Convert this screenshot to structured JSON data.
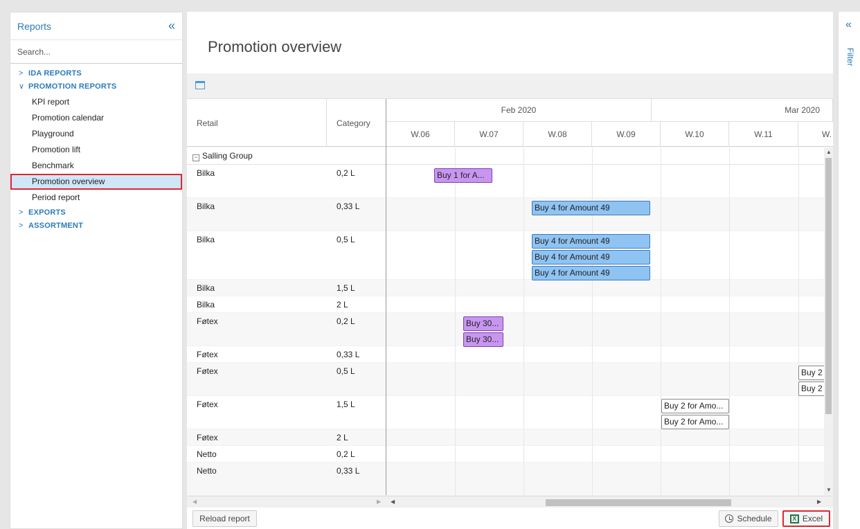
{
  "sidebar": {
    "title": "Reports",
    "collapse_icon": "«",
    "search_placeholder": "Search...",
    "groups": [
      {
        "label": "IDA REPORTS",
        "expanded": false,
        "items": []
      },
      {
        "label": "PROMOTION REPORTS",
        "expanded": true,
        "items": [
          "KPI report",
          "Promotion calendar",
          "Playground",
          "Promotion lift",
          "Benchmark",
          "Promotion overview",
          "Period report"
        ]
      },
      {
        "label": "EXPORTS",
        "expanded": false,
        "items": []
      },
      {
        "label": "ASSORTMENT",
        "expanded": false,
        "items": []
      }
    ],
    "active_item": "Promotion overview"
  },
  "main": {
    "title": "Promotion overview",
    "columns": {
      "retail": "Retail",
      "category": "Category"
    },
    "months": [
      "Feb 2020",
      "Mar 2020"
    ],
    "weeks": [
      "W.06",
      "W.07",
      "W.08",
      "W.09",
      "W.10",
      "W.11",
      "W."
    ],
    "group": "Salling Group",
    "rows": [
      {
        "retail": "Bilka",
        "category": "0,2 L"
      },
      {
        "retail": "Bilka",
        "category": "0,33 L"
      },
      {
        "retail": "Bilka",
        "category": "0,5 L"
      },
      {
        "retail": "Bilka",
        "category": "1,5 L"
      },
      {
        "retail": "Bilka",
        "category": "2 L"
      },
      {
        "retail": "Føtex",
        "category": "0,2 L"
      },
      {
        "retail": "Føtex",
        "category": "0,33 L"
      },
      {
        "retail": "Føtex",
        "category": "0,5 L"
      },
      {
        "retail": "Føtex",
        "category": "1,5 L"
      },
      {
        "retail": "Føtex",
        "category": "2 L"
      },
      {
        "retail": "Netto",
        "category": "0,2 L"
      },
      {
        "retail": "Netto",
        "category": "0,33 L"
      }
    ],
    "promotions": [
      {
        "label": "Buy 1 for A...",
        "color": "purple"
      },
      {
        "label": "Buy 4 for Amount 49",
        "color": "blue"
      },
      {
        "label": "Buy 4 for Amount 49",
        "color": "blue"
      },
      {
        "label": "Buy 4 for Amount 49",
        "color": "blue"
      },
      {
        "label": "Buy 4 for Amount 49",
        "color": "blue"
      },
      {
        "label": "Buy 30...",
        "color": "purple"
      },
      {
        "label": "Buy 30...",
        "color": "purple"
      },
      {
        "label": "Buy 2",
        "color": "white"
      },
      {
        "label": "Buy 2",
        "color": "white"
      },
      {
        "label": "Buy 2 for Amo...",
        "color": "white"
      },
      {
        "label": "Buy 2 for Amo...",
        "color": "white"
      }
    ],
    "footer": {
      "reload_label": "Reload report",
      "schedule_label": "Schedule",
      "excel_label": "Excel"
    }
  },
  "filter_pane": {
    "collapse_icon": "«",
    "label": "Filter"
  },
  "colors": {
    "accent": "#2b7bb9",
    "highlight_border": "#e0262f",
    "promo_blue": "#8fc3f2",
    "promo_purple": "#c896f0"
  }
}
